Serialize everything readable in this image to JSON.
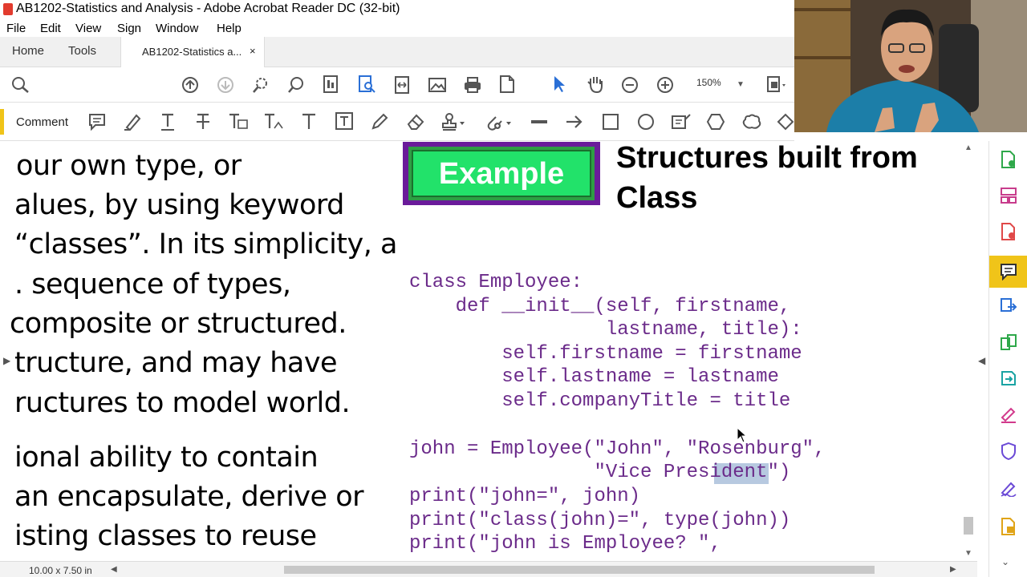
{
  "window": {
    "title": "AB1202-Statistics and Analysis - Adobe Acrobat Reader DC (32-bit)"
  },
  "menu": [
    "File",
    "Edit",
    "View",
    "Sign",
    "Window",
    "Help"
  ],
  "tabs": {
    "home": "Home",
    "tools": "Tools",
    "doc": "AB1202-Statistics a...",
    "close": "×"
  },
  "toolbar": {
    "zoom": "150%"
  },
  "commentbar": {
    "label": "Comment"
  },
  "slide": {
    "left_lines": [
      "our own type, or",
      "alues, by using keyword",
      "“classes”.  In its simplicity, a",
      ". sequence of types,",
      " composite or structured.",
      "tructure, and may have",
      "ructures to model world.",
      "ional ability to contain",
      "an encapsulate, derive or",
      "isting classes to reuse"
    ],
    "badge": "Example",
    "title_line1": "Structures built from",
    "title_line2": "Class",
    "code": [
      "class Employee:",
      "    def __init__(self, firstname,",
      "                 lastname, title):",
      "        self.firstname = firstname",
      "        self.lastname = lastname",
      "        self.companyTitle = title",
      "",
      "john = Employee(\"John\", \"Rosenburg\",",
      "                \"Vice President\")",
      "print(\"john=\", john)",
      "print(\"class(john)=\", type(john))",
      "print(\"john is Employee? \","
    ]
  },
  "statusbar": {
    "page_size": "10.00 x 7.50 in"
  },
  "colors": {
    "accent": "#f0c419",
    "code": "#6b2b8a",
    "badge_green": "#22e26a",
    "badge_frame": "#6a1b9a"
  }
}
